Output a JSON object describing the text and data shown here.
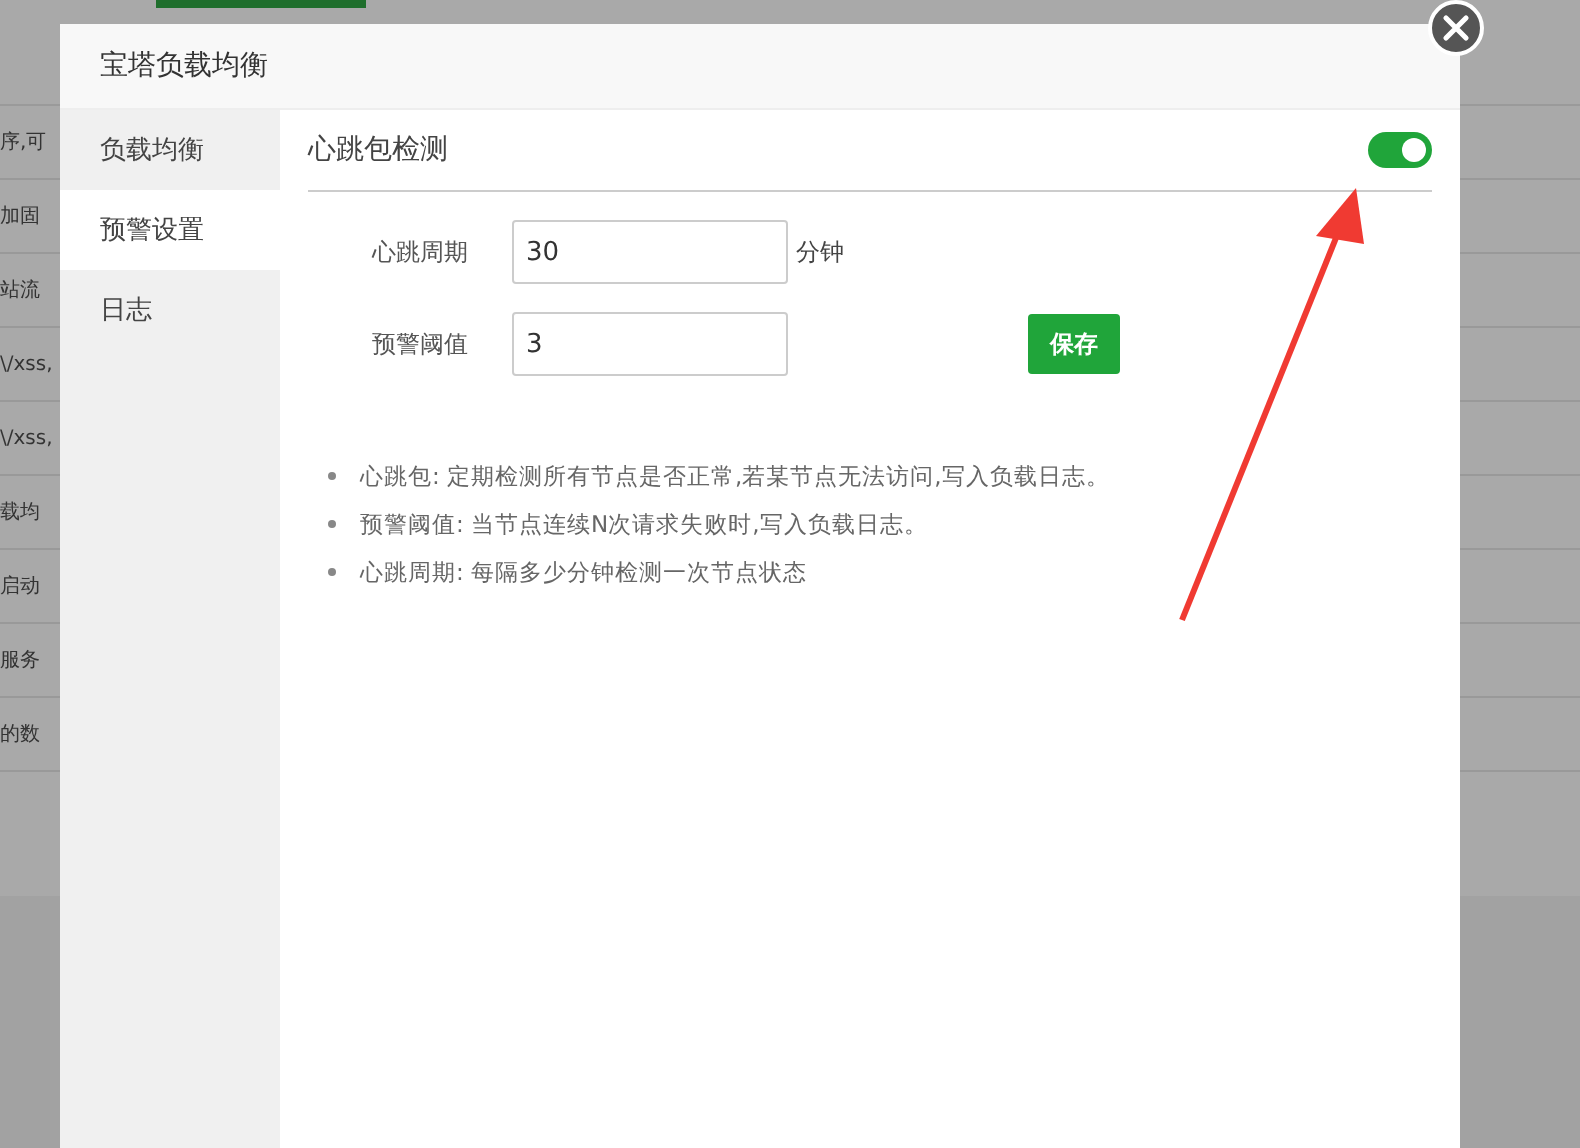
{
  "background_rows": [
    "序,可",
    "加固",
    "站流",
    "\\/xss,",
    "\\/xss,",
    "载均",
    "启动",
    "服务",
    "的数"
  ],
  "dialog": {
    "title": "宝塔负载均衡",
    "sidebar": [
      {
        "label": "负载均衡",
        "selected": false
      },
      {
        "label": "预警设置",
        "selected": true
      },
      {
        "label": "日志",
        "selected": false
      }
    ],
    "section": {
      "title": "心跳包检测",
      "on": true
    },
    "fields": [
      {
        "label": "心跳周期",
        "value": "30",
        "unit": "分钟"
      },
      {
        "label": "预警阈值",
        "value": "3"
      }
    ],
    "save_button": "保存",
    "notes": [
      "心跳包: 定期检测所有节点是否正常,若某节点无法访问,写入负载日志。",
      "预警阈值: 当节点连续N次请求失败时,写入负载日志。",
      "心跳周期: 每隔多少分钟检测一次节点状态"
    ]
  }
}
